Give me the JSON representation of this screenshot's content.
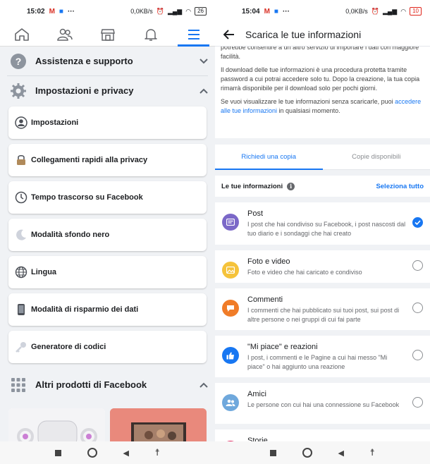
{
  "left": {
    "status": {
      "time": "15:02",
      "speed": "0,0KB/s",
      "battery": "26"
    },
    "tabs": [
      {
        "icon": "home-icon"
      },
      {
        "icon": "friends-icon"
      },
      {
        "icon": "marketplace-icon"
      },
      {
        "icon": "bell-icon"
      },
      {
        "icon": "menu-icon"
      }
    ],
    "help_section": "Assistenza e supporto",
    "settings_section": "Impostazioni e privacy",
    "menu_items": [
      {
        "label": "Impostazioni",
        "icon": "account-settings-icon"
      },
      {
        "label": "Collegamenti rapidi alla privacy",
        "icon": "lock-icon"
      },
      {
        "label": "Tempo trascorso su Facebook",
        "icon": "clock-icon"
      },
      {
        "label": "Modalità sfondo nero",
        "icon": "moon-icon"
      },
      {
        "label": "Lingua",
        "icon": "globe-icon"
      },
      {
        "label": "Modalità di risparmio dei dati",
        "icon": "phone-icon"
      },
      {
        "label": "Generatore di codici",
        "icon": "key-icon"
      }
    ],
    "other_section": "Altri prodotti di Facebook"
  },
  "right": {
    "status": {
      "time": "15:04",
      "speed": "0,0KB/s",
      "battery": "10"
    },
    "title": "Scarica le tue informazioni",
    "intro_cut": "potrebbe consentire a un altro servizio di importare i dati con maggiore facilità.",
    "intro_p1": "Il download delle tue informazioni è una procedura protetta tramite password a cui potrai accedere solo tu. Dopo la creazione, la tua copia rimarrà disponibile per il download solo per pochi giorni.",
    "intro_p2_a": "Se vuoi visualizzare le tue informazioni senza scaricarle, puoi ",
    "intro_p2_link": "accedere alle tue informazioni",
    "intro_p2_b": " in qualsiasi momento.",
    "tab_request": "Richiedi una copia",
    "tab_available": "Copie disponibili",
    "info_label": "Le tue informazioni",
    "select_all": "Seleziona tutto",
    "items": [
      {
        "title": "Post",
        "desc": "I post che hai condiviso su Facebook, i post nascosti dal tuo diario e i sondaggi che hai creato",
        "color": "#7b68c8",
        "icon": "post-icon",
        "checked": true
      },
      {
        "title": "Foto e video",
        "desc": "Foto e video che hai caricato e condiviso",
        "color": "#f5c33b",
        "icon": "photo-icon",
        "checked": false
      },
      {
        "title": "Commenti",
        "desc": "I commenti che hai pubblicato sui tuoi post, sui post di altre persone o nei gruppi di cui fai parte",
        "color": "#f07c28",
        "icon": "comment-icon",
        "checked": false
      },
      {
        "title": "\"Mi piace\" e reazioni",
        "desc": "I post, i commenti e le Pagine a cui hai messo \"Mi piace\" o hai aggiunto una reazione",
        "color": "#1877f2",
        "icon": "like-icon",
        "checked": false
      },
      {
        "title": "Amici",
        "desc": "Le persone con cui hai una connessione su Facebook",
        "color": "#6fa8dc",
        "icon": "friends-icon",
        "checked": false
      },
      {
        "title": "Storie",
        "desc": "",
        "color": "#e0245e",
        "icon": "stories-icon",
        "checked": false
      }
    ]
  }
}
